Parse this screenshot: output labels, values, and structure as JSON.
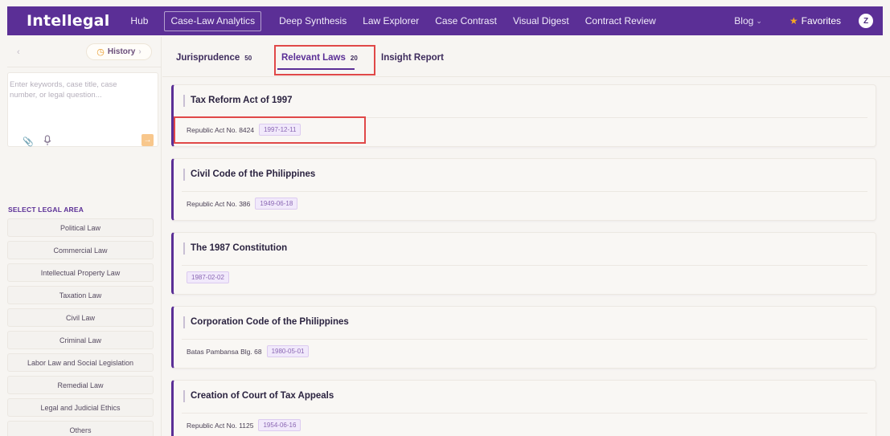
{
  "app": {
    "brand": "Intellegal"
  },
  "nav": {
    "items": [
      "Hub",
      "Case-Law Analytics",
      "Deep Synthesis",
      "Law Explorer",
      "Case Contrast",
      "Visual Digest",
      "Contract Review"
    ],
    "active": "Case-Law Analytics",
    "blog": "Blog",
    "favorites": "Favorites",
    "avatar_initial": "Z"
  },
  "sidebar": {
    "history_label": "History",
    "search_placeholder": "Enter keywords, case title, case number, or legal question...",
    "area_title": "SELECT LEGAL AREA",
    "areas": [
      "Political Law",
      "Commercial Law",
      "Intellectual Property Law",
      "Taxation Law",
      "Civil Law",
      "Criminal Law",
      "Labor Law and Social Legislation",
      "Remedial Law",
      "Legal and Judicial Ethics",
      "Others"
    ]
  },
  "tabs": {
    "jurisprudence": {
      "label": "Jurisprudence",
      "count": "50"
    },
    "relevant_laws": {
      "label": "Relevant Laws",
      "count": "20"
    },
    "insight_report": {
      "label": "Insight Report"
    },
    "active": "relevant_laws"
  },
  "laws": [
    {
      "title": "Tax Reform Act of 1997",
      "act_no": "Republic Act No. 8424",
      "date": "1997-12-11"
    },
    {
      "title": "Civil Code of the Philippines",
      "act_no": "Republic Act No. 386",
      "date": "1949-06-18"
    },
    {
      "title": "The 1987 Constitution",
      "act_no": "",
      "date": "1987-02-02"
    },
    {
      "title": "Corporation Code of the Philippines",
      "act_no": "Batas Pambansa Blg. 68",
      "date": "1980-05-01"
    },
    {
      "title": "Creation of Court of Tax Appeals",
      "act_no": "Republic Act No. 1125",
      "date": "1954-06-16"
    }
  ],
  "colors": {
    "brand_purple": "#5b2f96",
    "highlight_red": "#e04848",
    "star_orange": "#f5a623",
    "send_orange": "#f8c78c"
  }
}
